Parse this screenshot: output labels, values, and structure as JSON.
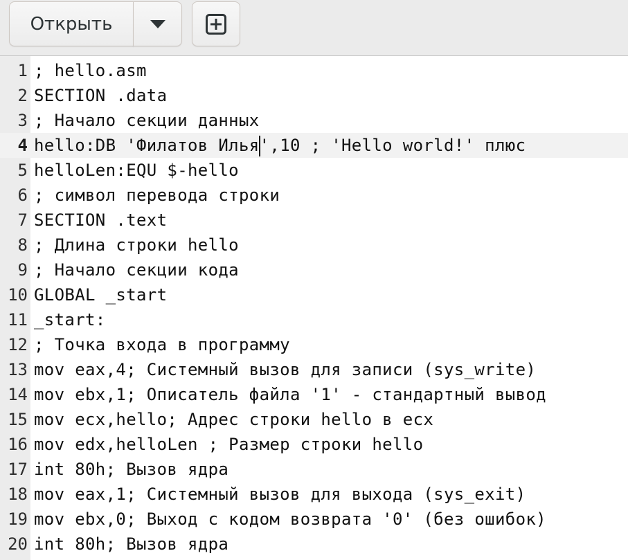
{
  "toolbar": {
    "open_label": "Открыть",
    "menu_icon": "chevron-down-icon",
    "new_tab_icon": "new-tab-icon"
  },
  "editor": {
    "current_line": 4,
    "caret_after": "hello:DB 'Филатов Илья",
    "lines": [
      {
        "num": "1",
        "text": "; hello.asm"
      },
      {
        "num": "2",
        "text": "SECTION .data"
      },
      {
        "num": "3",
        "text": "; Начало секции данных"
      },
      {
        "num": "4",
        "text": "hello:DB 'Филатов Илья',10 ; 'Hello world!' плюс"
      },
      {
        "num": "5",
        "text": "helloLen:EQU $-hello"
      },
      {
        "num": "6",
        "text": "; символ перевода строки"
      },
      {
        "num": "7",
        "text": "SECTION .text"
      },
      {
        "num": "8",
        "text": "; Длина строки hello"
      },
      {
        "num": "9",
        "text": "; Начало секции кода"
      },
      {
        "num": "10",
        "text": "GLOBAL _start"
      },
      {
        "num": "11",
        "text": "_start:"
      },
      {
        "num": "12",
        "text": "; Точка входа в программу"
      },
      {
        "num": "13",
        "text": "mov eax,4; Системный вызов для записи (sys_write)"
      },
      {
        "num": "14",
        "text": "mov ebx,1; Описатель файла '1' - стандартный вывод"
      },
      {
        "num": "15",
        "text": "mov ecx,hello; Адрес строки hello в ecx"
      },
      {
        "num": "16",
        "text": "mov edx,helloLen ; Размер строки hello"
      },
      {
        "num": "17",
        "text": "int 80h; Вызов ядра"
      },
      {
        "num": "18",
        "text": "mov eax,1; Системный вызов для выхода (sys_exit)"
      },
      {
        "num": "19",
        "text": "mov ebx,0; Выход с кодом возврата '0' (без ошибок)"
      },
      {
        "num": "20",
        "text": "int 80h; Вызов ядра"
      }
    ]
  }
}
